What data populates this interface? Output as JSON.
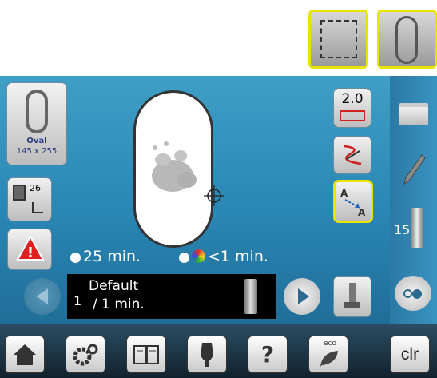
{
  "top_icons": [
    {
      "name": "rectangle-hoop-icon"
    },
    {
      "name": "oval-hoop-icon"
    }
  ],
  "hoop": {
    "name": "Oval",
    "size": "145 x 255"
  },
  "zoom": "2.0",
  "stitch_count": "26",
  "time": {
    "total": "25 min.",
    "color": "<1 min."
  },
  "color_bar": {
    "index": "1",
    "name": "Default",
    "time": "/ 1 min."
  },
  "thread_count": "15",
  "clear_label": "clr",
  "eco_label": "eco",
  "help_label": "?",
  "colors": {
    "accent": "#e8e400",
    "screen": "#3396c2",
    "warning": "#e02020"
  }
}
